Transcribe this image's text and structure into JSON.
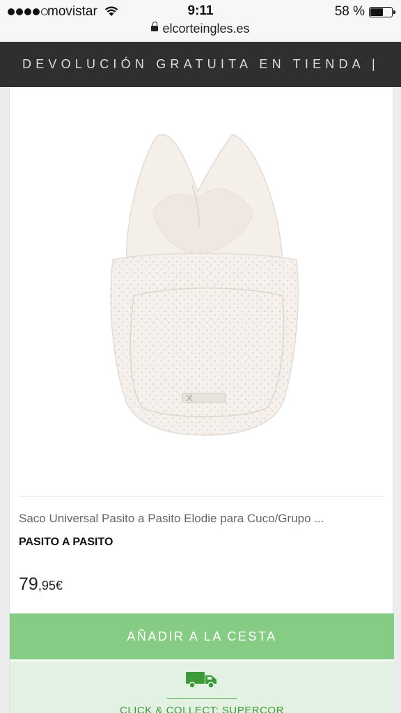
{
  "status_bar": {
    "carrier": "movistar",
    "time": "9:11",
    "battery_percent": "58 %",
    "url": "elcorteingles.es",
    "signal_icon": "signal-dots-icon",
    "wifi_icon": "wifi-icon",
    "battery_icon": "battery-icon",
    "lock_icon": "lock-icon"
  },
  "promo_banner": {
    "text": "DEVOLUCIÓN GRATUITA EN TIENDA |"
  },
  "product": {
    "title": "Saco Universal Pasito a Pasito Elodie para Cuco/Grupo ...",
    "brand": "PASITO A PASITO",
    "price_integer": "79",
    "price_decimal": ",95€",
    "image": "baby-sleeping-bag-image"
  },
  "actions": {
    "add_to_cart_label": "AÑADIR A LA CESTA",
    "click_collect_label": "CLICK & COLLECT: SUPERCOR",
    "click_collect_icon": "truck-icon"
  },
  "colors": {
    "promo_bg": "#2f2f2f",
    "add_button_bg": "#86cc84",
    "click_collect_bg": "#e2f1e1",
    "click_collect_accent": "#3d9a3b"
  }
}
